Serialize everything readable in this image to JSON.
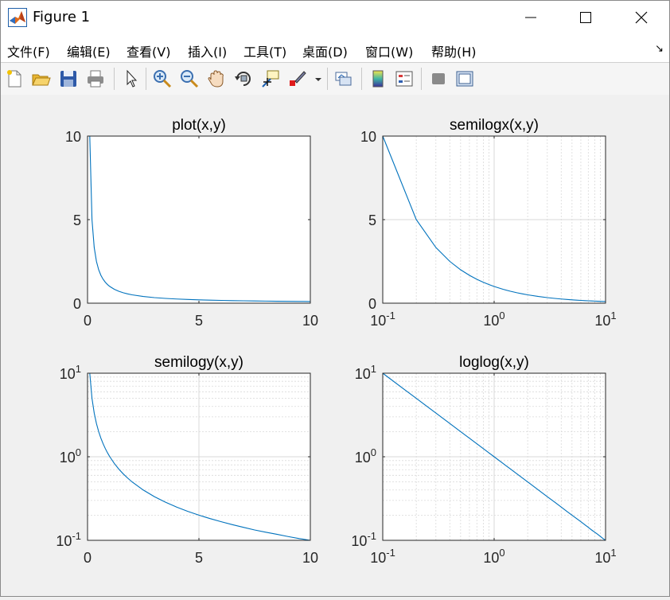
{
  "window": {
    "title": "Figure 1"
  },
  "menu": [
    "文件(F)",
    "编辑(E)",
    "查看(V)",
    "插入(I)",
    "工具(T)",
    "桌面(D)",
    "窗口(W)",
    "帮助(H)"
  ],
  "toolbar_icons": [
    "new-figure-icon",
    "open-file-icon",
    "save-icon",
    "print-icon",
    "pointer-icon",
    "zoom-in-icon",
    "zoom-out-icon",
    "pan-hand-icon",
    "rotate-3d-icon",
    "data-cursor-icon",
    "brush-icon",
    "brush-dropdown-icon",
    "link-plot-icon",
    "insert-colorbar-icon",
    "insert-legend-icon",
    "hide-plot-tools-icon",
    "show-plot-tools-icon"
  ],
  "colors": {
    "line": "#0072bd",
    "grid": "#d9d9d9",
    "axes": "#262626"
  },
  "chart_data": [
    {
      "type": "line",
      "title": "plot(x,y)",
      "xscale": "linear",
      "yscale": "linear",
      "xlim": [
        0,
        10
      ],
      "ylim": [
        0,
        10
      ],
      "xticks": [
        {
          "v": 0,
          "t": "0"
        },
        {
          "v": 5,
          "t": "5"
        },
        {
          "v": 10,
          "t": "10"
        }
      ],
      "yticks": [
        {
          "v": 0,
          "t": "0"
        },
        {
          "v": 5,
          "t": "5"
        },
        {
          "v": 10,
          "t": "10"
        }
      ],
      "grid": false,
      "x": [
        0.1,
        0.2,
        0.3,
        0.4,
        0.5,
        0.6,
        0.7,
        0.8,
        0.9,
        1.0,
        1.2,
        1.4,
        1.6,
        1.8,
        2.0,
        2.5,
        3.0,
        3.5,
        4.0,
        4.5,
        5.0,
        5.5,
        6.0,
        6.5,
        7.0,
        7.5,
        8.0,
        8.5,
        9.0,
        9.5,
        10.0
      ],
      "y": [
        10,
        5,
        3.333,
        2.5,
        2,
        1.667,
        1.429,
        1.25,
        1.111,
        1,
        0.833,
        0.714,
        0.625,
        0.556,
        0.5,
        0.4,
        0.333,
        0.286,
        0.25,
        0.222,
        0.2,
        0.182,
        0.167,
        0.154,
        0.143,
        0.133,
        0.125,
        0.118,
        0.111,
        0.105,
        0.1
      ]
    },
    {
      "type": "line",
      "title": "semilogx(x,y)",
      "xscale": "log",
      "yscale": "linear",
      "xlim": [
        0.1,
        10
      ],
      "ylim": [
        0,
        10
      ],
      "xticks": [
        {
          "v": 0.1,
          "b": "10",
          "e": "-1"
        },
        {
          "v": 1,
          "b": "10",
          "e": "0"
        },
        {
          "v": 10,
          "b": "10",
          "e": "1"
        }
      ],
      "yticks": [
        {
          "v": 0,
          "t": "0"
        },
        {
          "v": 5,
          "t": "5"
        },
        {
          "v": 10,
          "t": "10"
        }
      ],
      "grid": true,
      "x": [
        0.1,
        0.2,
        0.3,
        0.4,
        0.5,
        0.6,
        0.7,
        0.8,
        0.9,
        1.0,
        1.2,
        1.4,
        1.6,
        1.8,
        2.0,
        2.5,
        3.0,
        3.5,
        4.0,
        4.5,
        5.0,
        5.5,
        6.0,
        6.5,
        7.0,
        7.5,
        8.0,
        8.5,
        9.0,
        9.5,
        10.0
      ],
      "y": [
        10,
        5,
        3.333,
        2.5,
        2,
        1.667,
        1.429,
        1.25,
        1.111,
        1,
        0.833,
        0.714,
        0.625,
        0.556,
        0.5,
        0.4,
        0.333,
        0.286,
        0.25,
        0.222,
        0.2,
        0.182,
        0.167,
        0.154,
        0.143,
        0.133,
        0.125,
        0.118,
        0.111,
        0.105,
        0.1
      ]
    },
    {
      "type": "line",
      "title": "semilogy(x,y)",
      "xscale": "linear",
      "yscale": "log",
      "xlim": [
        0,
        10
      ],
      "ylim": [
        0.1,
        10
      ],
      "xticks": [
        {
          "v": 0,
          "t": "0"
        },
        {
          "v": 5,
          "t": "5"
        },
        {
          "v": 10,
          "t": "10"
        }
      ],
      "yticks": [
        {
          "v": 0.1,
          "b": "10",
          "e": "-1"
        },
        {
          "v": 1,
          "b": "10",
          "e": "0"
        },
        {
          "v": 10,
          "b": "10",
          "e": "1"
        }
      ],
      "grid": true,
      "x": [
        0.1,
        0.2,
        0.3,
        0.4,
        0.5,
        0.6,
        0.7,
        0.8,
        0.9,
        1.0,
        1.2,
        1.4,
        1.6,
        1.8,
        2.0,
        2.5,
        3.0,
        3.5,
        4.0,
        4.5,
        5.0,
        5.5,
        6.0,
        6.5,
        7.0,
        7.5,
        8.0,
        8.5,
        9.0,
        9.5,
        10.0
      ],
      "y": [
        10,
        5,
        3.333,
        2.5,
        2,
        1.667,
        1.429,
        1.25,
        1.111,
        1,
        0.833,
        0.714,
        0.625,
        0.556,
        0.5,
        0.4,
        0.333,
        0.286,
        0.25,
        0.222,
        0.2,
        0.182,
        0.167,
        0.154,
        0.143,
        0.133,
        0.125,
        0.118,
        0.111,
        0.105,
        0.1
      ]
    },
    {
      "type": "line",
      "title": "loglog(x,y)",
      "xscale": "log",
      "yscale": "log",
      "xlim": [
        0.1,
        10
      ],
      "ylim": [
        0.1,
        10
      ],
      "xticks": [
        {
          "v": 0.1,
          "b": "10",
          "e": "-1"
        },
        {
          "v": 1,
          "b": "10",
          "e": "0"
        },
        {
          "v": 10,
          "b": "10",
          "e": "1"
        }
      ],
      "yticks": [
        {
          "v": 0.1,
          "b": "10",
          "e": "-1"
        },
        {
          "v": 1,
          "b": "10",
          "e": "0"
        },
        {
          "v": 10,
          "b": "10",
          "e": "1"
        }
      ],
      "grid": true,
      "x": [
        0.1,
        0.2,
        0.3,
        0.4,
        0.5,
        0.6,
        0.7,
        0.8,
        0.9,
        1.0,
        1.2,
        1.4,
        1.6,
        1.8,
        2.0,
        2.5,
        3.0,
        3.5,
        4.0,
        4.5,
        5.0,
        5.5,
        6.0,
        6.5,
        7.0,
        7.5,
        8.0,
        8.5,
        9.0,
        9.5,
        10.0
      ],
      "y": [
        10,
        5,
        3.333,
        2.5,
        2,
        1.667,
        1.429,
        1.25,
        1.111,
        1,
        0.833,
        0.714,
        0.625,
        0.556,
        0.5,
        0.4,
        0.333,
        0.286,
        0.25,
        0.222,
        0.2,
        0.182,
        0.167,
        0.154,
        0.143,
        0.133,
        0.125,
        0.118,
        0.111,
        0.105,
        0.1
      ]
    }
  ]
}
